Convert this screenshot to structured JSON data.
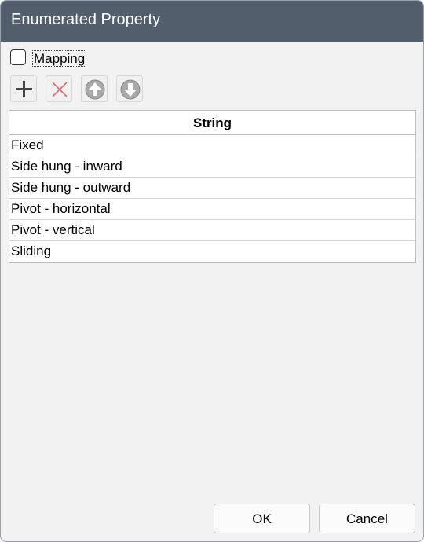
{
  "window": {
    "title": "Enumerated Property"
  },
  "mapping": {
    "label": "Mapping",
    "checked": false
  },
  "toolbar": {
    "buttons": [
      {
        "name": "add",
        "icon": "plus-icon"
      },
      {
        "name": "delete",
        "icon": "close-icon"
      },
      {
        "name": "move-up",
        "icon": "arrow-up-circle-icon"
      },
      {
        "name": "move-down",
        "icon": "arrow-down-circle-icon"
      }
    ]
  },
  "table": {
    "header": "String",
    "rows": [
      "Fixed",
      "Side hung - inward",
      "Side hung - outward",
      "Pivot - horizontal",
      "Pivot - vertical",
      "Sliding"
    ]
  },
  "footer": {
    "ok_label": "OK",
    "cancel_label": "Cancel"
  },
  "colors": {
    "titlebar": "#525e6b",
    "dialog_background": "#f2f2f2",
    "delete_icon": "#e06a6a",
    "arrow_icon_fill": "#a9a9a9"
  }
}
